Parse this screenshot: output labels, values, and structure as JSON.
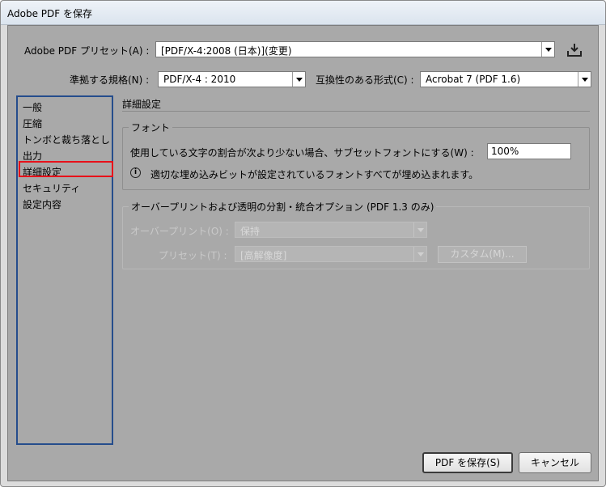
{
  "window": {
    "title": "Adobe PDF を保存"
  },
  "preset": {
    "label": "Adobe PDF プリセット(A) :",
    "value": "[PDF/X-4:2008 (日本)](変更)",
    "save_icon": "save-preset-icon"
  },
  "standard": {
    "label": "準拠する規格(N) :",
    "value": "PDF/X-4 : 2010"
  },
  "compat": {
    "label": "互換性のある形式(C) :",
    "value": "Acrobat 7 (PDF 1.6)"
  },
  "nav": {
    "items": [
      {
        "label": "一般"
      },
      {
        "label": "圧縮"
      },
      {
        "label": "トンボと裁ち落とし"
      },
      {
        "label": "出力"
      },
      {
        "label": "詳細設定"
      },
      {
        "label": "セキュリティ"
      },
      {
        "label": "設定内容"
      }
    ],
    "selected_index": 4
  },
  "section": {
    "title": "詳細設定"
  },
  "font_group": {
    "legend": "フォント",
    "subset_label": "使用している文字の割合が次より少ない場合、サブセットフォントにする(W) :",
    "subset_value": "100%",
    "info_text": "適切な埋め込みビットが設定されているフォントすべてが埋め込まれます。"
  },
  "overprint_group": {
    "legend": "オーバープリントおよび透明の分割・統合オプション (PDF 1.3 のみ)",
    "overprint_label": "オーバープリント(O) :",
    "overprint_value": "保持",
    "preset_label": "プリセット(T) :",
    "preset_value": "[高解像度]",
    "custom_button": "カスタム(M)..."
  },
  "buttons": {
    "save": "PDF を保存(S)",
    "cancel": "キャンセル"
  }
}
